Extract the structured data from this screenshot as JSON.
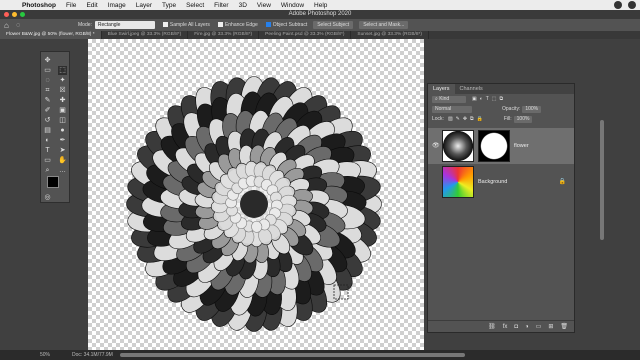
{
  "menubar": {
    "app": "Photoshop",
    "items": [
      "File",
      "Edit",
      "Image",
      "Layer",
      "Type",
      "Select",
      "Filter",
      "3D",
      "View",
      "Window",
      "Help"
    ]
  },
  "window": {
    "title": "Adobe Photoshop 2020"
  },
  "options": {
    "mode_label": "Mode:",
    "mode_value": "Rectangle",
    "sample_all": "Sample All Layers",
    "enhance_edge": "Enhance Edge",
    "object_subtract": "Object Subtract",
    "select_subject": "Select Subject",
    "select_and_mask": "Select and Mask..."
  },
  "tabs": [
    "Flower B&W.jpg @ 50% (flower, RGB/8) *",
    "Blue Swirl.jpeg @ 33.3% (RGB/8*)",
    "Fire.jpg @ 33.3% (RGB/8*)",
    "Peeling Paint.psd @ 33.3% (RGB/8*)",
    "Sunset.jpg @ 33.3% (RGB/8*)"
  ],
  "layers_panel": {
    "tabs": [
      "Layers",
      "Channels"
    ],
    "filter": "Kind",
    "blend_mode": "Normal",
    "opacity_label": "Opacity:",
    "opacity": "100%",
    "lock_label": "Lock:",
    "fill_label": "Fill:",
    "fill": "100%",
    "layers": [
      {
        "name": "flower",
        "selected": true
      },
      {
        "name": "Background",
        "selected": false
      }
    ]
  },
  "status": {
    "zoom": "50%",
    "doc": "Doc: 34.1M/77.9M"
  },
  "colors": {
    "foreground": "#000000",
    "background": "#e832e8",
    "accent": "#2680eb"
  }
}
